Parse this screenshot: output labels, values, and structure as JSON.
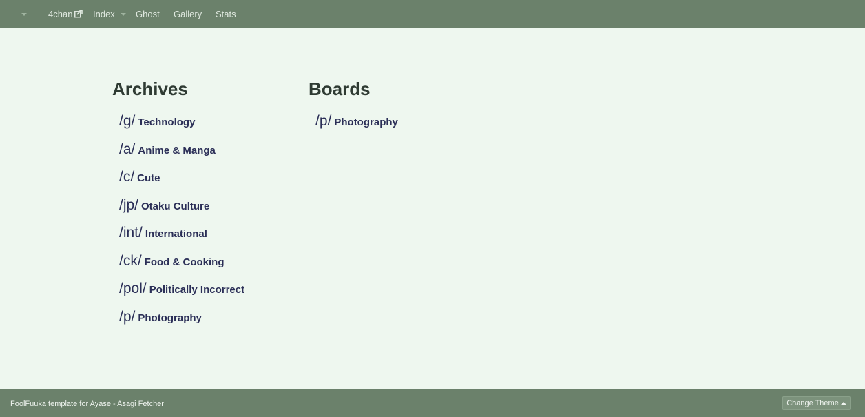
{
  "nav": {
    "items": [
      {
        "label": "4chan",
        "icon": "external-link-icon"
      },
      {
        "label": "Index",
        "icon": "caret-down-icon"
      },
      {
        "label": "Ghost"
      },
      {
        "label": "Gallery"
      },
      {
        "label": "Stats"
      }
    ]
  },
  "archives": {
    "title": "Archives",
    "boards": [
      {
        "code": "/g/",
        "name": "Technology"
      },
      {
        "code": "/a/",
        "name": "Anime & Manga"
      },
      {
        "code": "/c/",
        "name": "Cute"
      },
      {
        "code": "/jp/",
        "name": "Otaku Culture"
      },
      {
        "code": "/int/",
        "name": "International"
      },
      {
        "code": "/ck/",
        "name": "Food & Cooking"
      },
      {
        "code": "/pol/",
        "name": "Politically Incorrect"
      },
      {
        "code": "/p/",
        "name": "Photography"
      }
    ]
  },
  "boards": {
    "title": "Boards",
    "boards": [
      {
        "code": "/p/",
        "name": "Photography"
      }
    ]
  },
  "footer": {
    "text": "FoolFuuka template for Ayase - Asagi Fetcher",
    "theme_button": "Change Theme",
    "theme_icon": "caret-up-icon"
  },
  "colors": {
    "navbar": "#6b816b",
    "background": "#eef7ef",
    "link": "#2b2f57",
    "heading": "#2f3b33"
  }
}
